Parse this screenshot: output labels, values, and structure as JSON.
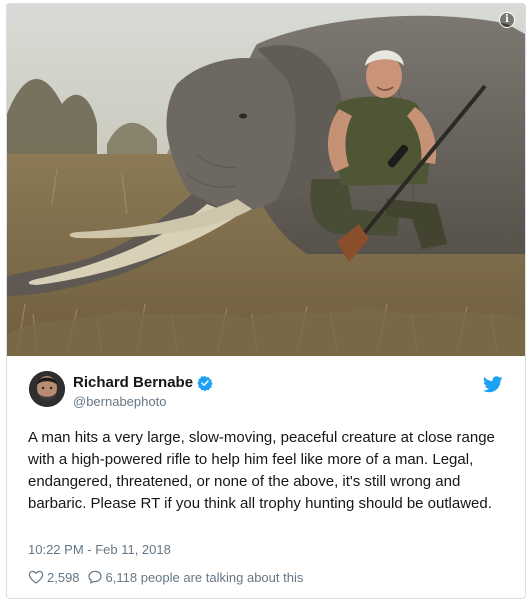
{
  "tweet": {
    "display_name": "Richard Bernabe",
    "handle": "@bernabephoto",
    "verified": true,
    "text": "A man hits a very large, slow-moving, peaceful creature at close range with a high-powered rifle to help him feel like more of a man. Legal, endangered, threatened, or none of the above, it's still wrong and barbaric. Please RT if you think all trophy hunting should be outlawed.",
    "timestamp": "10:22 PM - Feb 11, 2018",
    "likes": "2,598",
    "replies_label": "6,118 people are talking about this"
  },
  "icons": {
    "info": "info-icon",
    "verified": "verified-badge-icon",
    "twitter": "twitter-bird-icon",
    "like": "heart-icon",
    "reply": "speech-bubble-icon"
  },
  "colors": {
    "twitter_blue": "#1da1f2",
    "verified_blue": "#1da1f2",
    "secondary_text": "#657786",
    "border": "#d8dee2"
  }
}
